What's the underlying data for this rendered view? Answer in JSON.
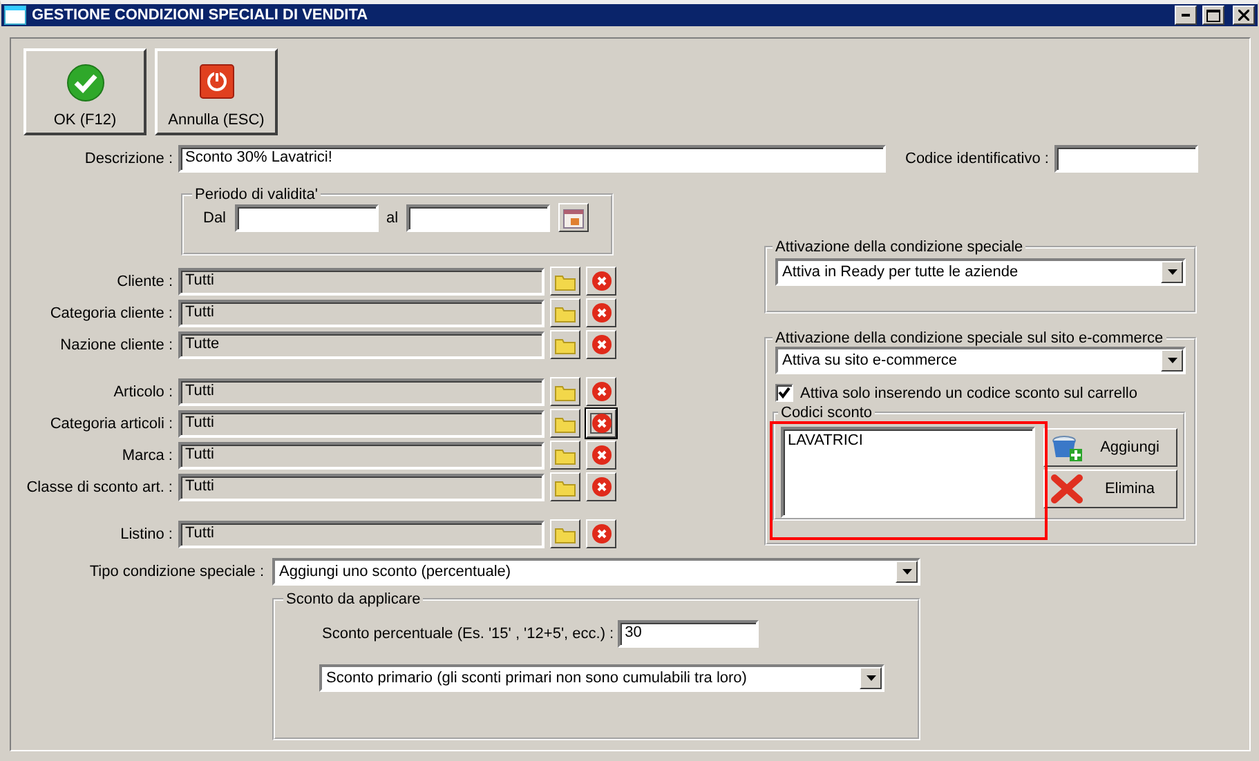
{
  "window": {
    "title": "GESTIONE CONDIZIONI SPECIALI DI VENDITA"
  },
  "toolbar": [
    {
      "kind": "ok",
      "label": "OK (F12)"
    },
    {
      "kind": "cancel",
      "label": "Annulla (ESC)"
    }
  ],
  "descrizione": {
    "label": "Descrizione :",
    "value": "Sconto 30% Lavatrici!"
  },
  "codice": {
    "label": "Codice identificativo :"
  },
  "periodo": {
    "title": "Periodo di validita'",
    "from_label": "Dal",
    "to_label": "al"
  },
  "filter_groups": [
    [
      {
        "label": "Cliente :",
        "value": "Tutti",
        "clear_focused": false
      },
      {
        "label": "Categoria cliente :",
        "value": "Tutti",
        "clear_focused": false
      },
      {
        "label": "Nazione cliente :",
        "value": "Tutte",
        "clear_focused": false
      }
    ],
    [
      {
        "label": "Articolo :",
        "value": "Tutti",
        "clear_focused": false
      },
      {
        "label": "Categoria articoli :",
        "value": "Tutti",
        "clear_focused": true
      },
      {
        "label": "Marca :",
        "value": "Tutti",
        "clear_focused": false
      },
      {
        "label": "Classe di sconto art. :",
        "value": "Tutti",
        "clear_focused": false
      }
    ],
    [
      {
        "label": "Listino :",
        "value": "Tutti",
        "clear_focused": false
      }
    ]
  ],
  "attivazione": {
    "title": "Attivazione della condizione speciale",
    "select": "Attiva in Ready per tutte le aziende"
  },
  "ecommerce": {
    "title": "Attivazione della condizione speciale sul sito e-commerce",
    "select": "Attiva su sito e-commerce",
    "only_with_code": {
      "label": "Attiva solo inserendo un codice sconto sul carrello",
      "checked": true
    },
    "codes": {
      "title": "Codici sconto",
      "items": [
        "LAVATRICI"
      ],
      "highlighted": true
    },
    "buttons": [
      {
        "kind": "add",
        "label": "Aggiungi"
      },
      {
        "kind": "delete",
        "label": "Elimina"
      }
    ]
  },
  "tipo": {
    "label": "Tipo condizione speciale :",
    "select": "Aggiungi uno sconto (percentuale)"
  },
  "sconto": {
    "title": "Sconto da applicare",
    "percent_label": "Sconto percentuale (Es. '15' , '12+5', ecc.) :",
    "percent_value": "30",
    "type_select": "Sconto primario (gli sconti primari non sono cumulabili tra loro)"
  }
}
